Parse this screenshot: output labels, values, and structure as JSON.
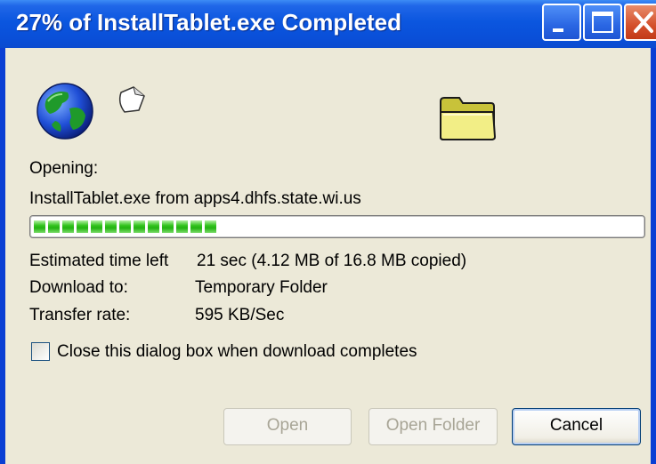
{
  "window": {
    "title": "27% of InstallTablet.exe Completed",
    "progress_percent": 27
  },
  "titlebar_buttons": {
    "minimize_icon": "minimize-icon",
    "maximize_icon": "maximize-icon",
    "close_icon": "close-icon"
  },
  "icons": {
    "globe": "globe-icon",
    "document": "flying-document-icon",
    "folder": "folder-icon"
  },
  "status": {
    "opening_label": "Opening:",
    "file_line": "InstallTablet.exe from apps4.dhfs.state.wi.us",
    "progress_chunks_filled": 13
  },
  "details": {
    "time_left_label": "Estimated time left",
    "time_left_value": "21 sec (4.12 MB of 16.8 MB copied)",
    "download_to_label": "Download to:",
    "download_to_value": "Temporary Folder",
    "transfer_rate_label": "Transfer rate:",
    "transfer_rate_value": "595 KB/Sec"
  },
  "options": {
    "close_when_done_label": "Close this dialog box when download completes",
    "close_when_done_checked": false
  },
  "buttons": {
    "open": "Open",
    "open_folder": "Open Folder",
    "cancel": "Cancel"
  },
  "colors": {
    "titlebar": "#0a4fd8",
    "progress_fill": "#22b310",
    "dialog_bg": "#ece9d8",
    "close_button": "#d4502c"
  }
}
